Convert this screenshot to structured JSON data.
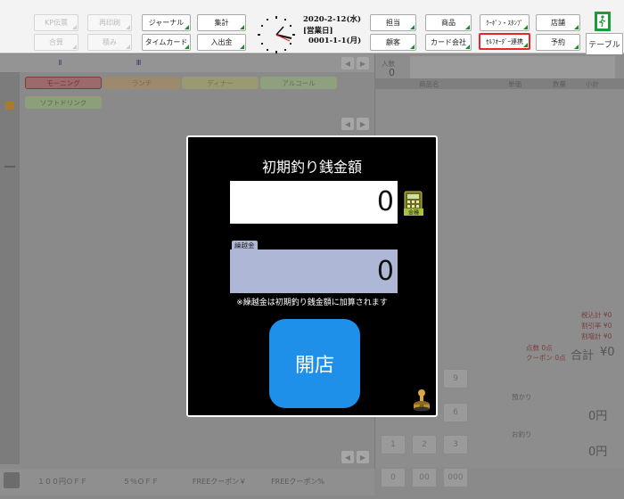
{
  "topbar": {
    "buttons_row1": [
      "KP伝票",
      "再印刷",
      "ジャーナル",
      "集計",
      "担当",
      "商品",
      "ｸｰﾎﾟﾝ・ｽﾀﾝﾌﾟ",
      "店舗"
    ],
    "buttons_row2": [
      "合算",
      "積み",
      "タイムカード",
      "入出金",
      "顧客",
      "カード会社",
      "ｾﾙﾌｵｰﾀﾞｰ連携",
      "予約"
    ],
    "date": "2020-2-12(水)",
    "business_day_label": "[営業日]",
    "business_day": "0001-1-1(月)",
    "table_tab": "テーブル"
  },
  "background": {
    "category_tabs": [
      "Ⅱ",
      "Ⅲ"
    ],
    "menu_pills": [
      "モーニング",
      "ランチ",
      "ディナー",
      "アルコール",
      "ソフトドリンク"
    ],
    "headcount_label": "人数",
    "headcount": "0",
    "item_header": "商品名",
    "unit_price_header": "単価",
    "qty_header": "数量",
    "subtotal_header": "小計",
    "summary": [
      "税込計 ¥0",
      "割引率 ¥0",
      "割増計 ¥0",
      "点数 0点",
      "クーポン 0点"
    ],
    "total_label": "合計",
    "total": "¥0",
    "deposit_label": "預かり",
    "deposit": "0円",
    "change_label": "お釣り",
    "change": "0円",
    "coupons": [
      "１００円ＯＦＦ",
      "５％ＯＦＦ",
      "FREEクーポン￥",
      "FREEクーポン%"
    ],
    "keypad": [
      "9",
      "6",
      "3",
      "2",
      "1",
      "0",
      "00",
      "000"
    ]
  },
  "modal": {
    "title": "初期釣り銭金額",
    "amount": "0",
    "calc_label": "金種",
    "carry_label": "繰越金",
    "carry_amount": "0",
    "note": "※繰越金は初期釣り銭金額に加算されます",
    "open_button": "開店"
  }
}
